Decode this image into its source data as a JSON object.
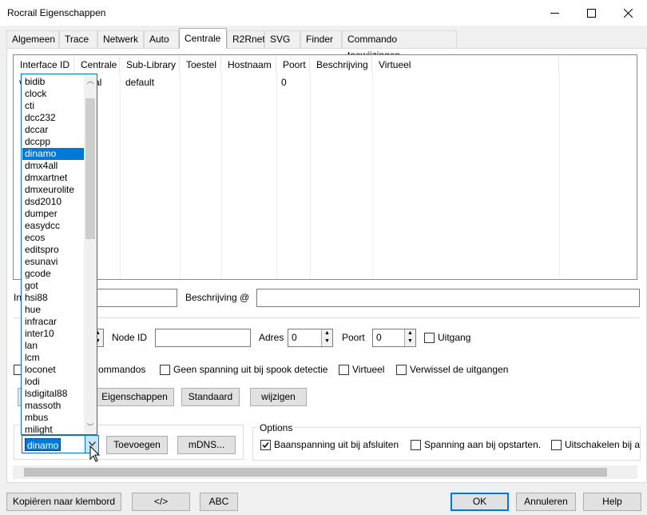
{
  "window": {
    "title": "Rocrail Eigenschappen"
  },
  "tabs": [
    {
      "label": "Algemeen"
    },
    {
      "label": "Trace"
    },
    {
      "label": "Netwerk"
    },
    {
      "label": "Auto"
    },
    {
      "label": "Centrale",
      "active": true
    },
    {
      "label": "R2Rnet"
    },
    {
      "label": "SVG"
    },
    {
      "label": "Finder"
    },
    {
      "label": "Commando toewijzingen"
    }
  ],
  "grid": {
    "columns": [
      "Interface ID",
      "Centrale",
      "Sub-Library",
      "Toestel",
      "Hostnaam",
      "Poort",
      "Beschrijving",
      "Virtueel"
    ],
    "rows": [
      {
        "interface_id": "v",
        "centrale": "al",
        "sub_library": "default",
        "toestel": "",
        "hostnaam": "",
        "poort": "0",
        "beschrijving": "",
        "virtueel": ""
      }
    ]
  },
  "form": {
    "interface_label": "In",
    "interface_value": "",
    "beschrijving_label": "Beschrijving @",
    "beschrijving_value": "",
    "node_id_label": "Node ID",
    "node_id_value": "",
    "adres_label": "Adres",
    "adres_value": "0",
    "poort_label": "Poort",
    "poort_value": "0",
    "uitgang_label": "Uitgang",
    "commandos_label": "ommandos",
    "spook_label": "Geen spanning uit bij spook detectie",
    "virtueel_label": "Virtueel",
    "verwissel_label": "Verwissel de uitgangen"
  },
  "actions": {
    "eigenschappen": "Eigenschappen",
    "standaard": "Standaard",
    "wijzigen": "wijzigen"
  },
  "add_section": {
    "selected_library": "dinamo",
    "toevoegen": "Toevoegen",
    "mdns": "mDNS..."
  },
  "options": {
    "title": "Options",
    "baanspanning_afsluiten": {
      "label": "Baanspanning uit bij afsluiten",
      "checked": true
    },
    "spanning_opstarten": {
      "label": "Spanning aan bij opstarten.",
      "checked": false
    },
    "uitschakelen": {
      "label": "Uitschakelen bij a",
      "checked": false
    }
  },
  "dropdown": {
    "items": [
      "bidib",
      "clock",
      "cti",
      "dcc232",
      "dccar",
      "dccpp",
      "dinamo",
      "dmx4all",
      "dmxartnet",
      "dmxeurolite",
      "dsd2010",
      "dumper",
      "easydcc",
      "ecos",
      "editspro",
      "esunavi",
      "gcode",
      "got",
      "hsi88",
      "hue",
      "infracar",
      "inter10",
      "lan",
      "lcm",
      "loconet",
      "lodi",
      "lsdigital88",
      "massoth",
      "mbus",
      "milight"
    ],
    "selected": "dinamo"
  },
  "footer": {
    "copy": "Kopiëren naar klembord",
    "code": "</>",
    "abc": "ABC",
    "ok": "OK",
    "cancel": "Annuleren",
    "help": "Help"
  },
  "icons": {
    "minimize": "minimize-icon",
    "maximize": "maximize-icon",
    "close": "close-icon",
    "chevron": "chevron-down-icon"
  },
  "colors": {
    "accent": "#0078d7"
  }
}
